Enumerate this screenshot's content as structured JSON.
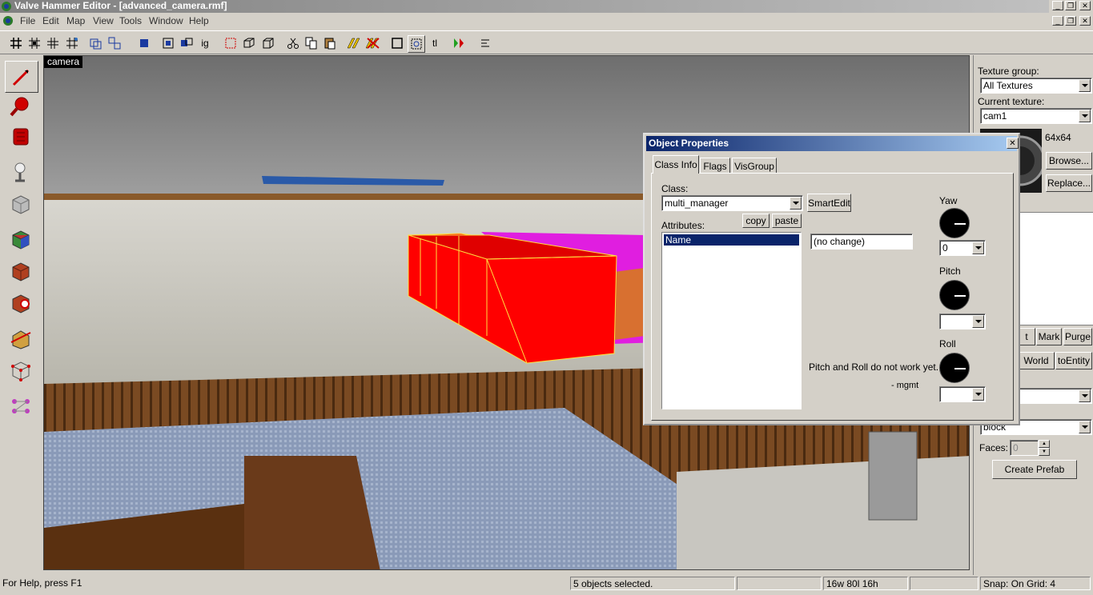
{
  "app": {
    "title": "Valve Hammer Editor - [advanced_camera.rmf]",
    "win_min": "_",
    "win_restore": "❐",
    "win_close": "✕"
  },
  "menu": {
    "items": [
      "File",
      "Edit",
      "Map",
      "View",
      "Tools",
      "Window",
      "Help"
    ]
  },
  "toolbar": {
    "ig_label": "ig",
    "tl_label": "tl"
  },
  "viewport": {
    "label": "camera"
  },
  "right_panel": {
    "texture_group_label": "Texture group:",
    "texture_group_value": "All Textures",
    "current_texture_label": "Current texture:",
    "current_texture_value": "cam1",
    "texture_size": "64x64",
    "browse_button": "Browse...",
    "replace_button": "Replace...",
    "partial_t": "t",
    "mark_button": "Mark",
    "purge_button": "Purge",
    "toworld_button": "World",
    "toentity_button": "toEntity",
    "block_value": "block",
    "faces_label": "Faces:",
    "faces_value": "0",
    "create_prefab_button": "Create Prefab"
  },
  "dialog": {
    "title": "Object Properties",
    "tabs": [
      "Class Info",
      "Flags",
      "VisGroup"
    ],
    "class_label": "Class:",
    "class_value": "multi_manager",
    "smartedit_button": "SmartEdit",
    "attributes_label": "Attributes:",
    "copy_button": "copy",
    "paste_button": "paste",
    "attributes": [
      "Name"
    ],
    "value_field": "(no change)",
    "yaw_label": "Yaw",
    "yaw_value": "0",
    "pitch_label": "Pitch",
    "pitch_value": "",
    "roll_label": "Roll",
    "roll_value": "",
    "note_line1": "Pitch and Roll do not work yet. ->",
    "note_line2": "- mgmt"
  },
  "statusbar": {
    "help": "For Help, press F1",
    "selection": "5 objects selected.",
    "size": "16w 80l 16h",
    "snap": "Snap: On Grid: 4"
  },
  "colors": {
    "title_active": "#0a246a",
    "selected_red": "#ff0000",
    "magenta": "#e01ee0",
    "face": "#d4d0c8"
  }
}
